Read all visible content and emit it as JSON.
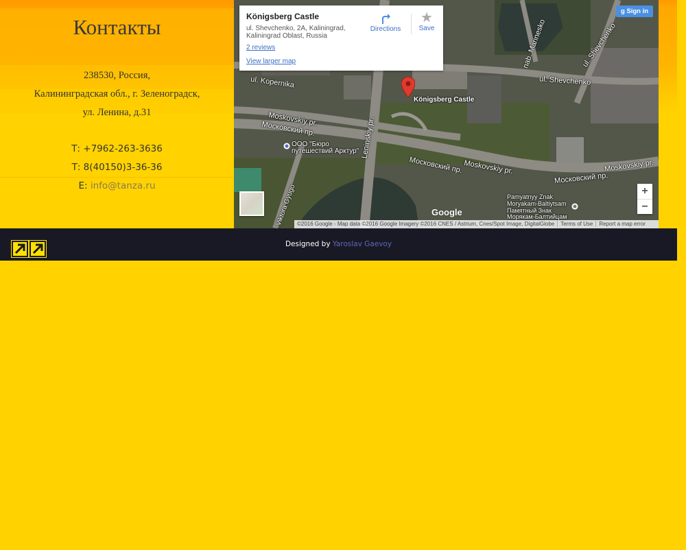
{
  "contacts": {
    "heading": "Контакты",
    "address": {
      "line1": "238530, Россия,",
      "line2": "Калининградская обл., г. Зеленоградск,",
      "line3": "ул. Ленина, д.31"
    },
    "phone1": "Т: +7962-263-3636",
    "phone2": "Т: 8(40150)3-36-36",
    "email_prefix": "E: ",
    "email": "info@tanza.ru"
  },
  "map": {
    "place_name": "Königsberg Castle",
    "place_address": "ul. Shevchenko, 2A, Kaliningrad, Kaliningrad Oblast, Russia",
    "reviews_link": "2 reviews",
    "larger_map_link": "View larger map",
    "directions_label": "Directions",
    "save_label": "Save",
    "sign_in_label": "Sign in",
    "zoom_in": "+",
    "zoom_out": "−",
    "google_logo": "Google",
    "attribution": "©2016 Google - Map data ©2016 Google Imagery ©2016 CNES / Astrium, Cnes/Spot Image, DigitalGlobe",
    "terms_link": "Terms of Use",
    "report_link": "Report a map error",
    "marker_label": "Königsberg Castle",
    "street_labels": {
      "kopernika": "ul. Kopernika",
      "shevchenko1": "ul. Shevchenko",
      "shevchenko2": "ul. Shevchenko",
      "marinesko": "nab. Marinesko",
      "moskovskiy_en1": "Moskovskiy pr.",
      "moskovskiy_ru1": "Московский пр.",
      "moskovskiy_ru2": "Московский пр.",
      "moskovskiy_en2": "Moskovskiy pr.",
      "moskovskiy_en3": "Moskovskiy pr.",
      "moskovskiy_ru3": "Московский пр.",
      "leninskiy": "Leninskiy pr.",
      "gyugo": "ul. Viktora Gyugo",
      "biuro1": "ООО \"Бюро",
      "biuro2": "путешествий Арктур\"",
      "pamyatny1": "Pamyatnyy Znak",
      "pamyatny2": "Moryakam-Baltiytsam",
      "pamyatny3": "Памятный Знак",
      "pamyatny4": "Морякам-Балтийцам"
    }
  },
  "footer": {
    "designed_by": "Designed by ",
    "designer": "Yaroslav Gaevoy"
  }
}
